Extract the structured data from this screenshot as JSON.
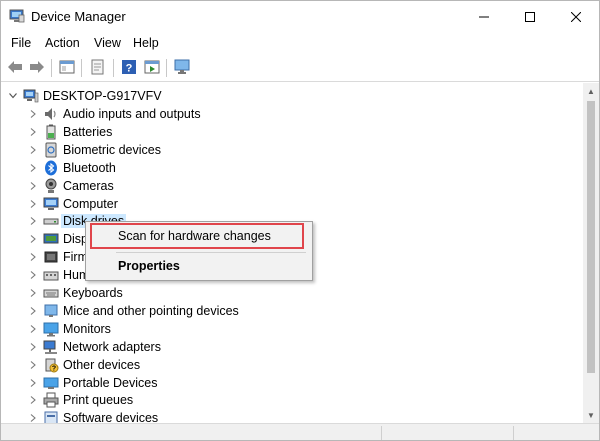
{
  "window": {
    "title": "Device Manager",
    "accent_highlight": "#e0454b",
    "selection_color": "#cce8ff"
  },
  "menu": {
    "items": [
      "File",
      "Action",
      "View",
      "Help"
    ]
  },
  "toolbar": {
    "buttons": [
      "back-arrow-icon",
      "forward-arrow-icon",
      "properties-pane-icon",
      "update-driver-icon",
      "help-icon",
      "action-pane-icon",
      "scan-monitor-icon"
    ]
  },
  "tree": {
    "root": "DESKTOP-G917VFV",
    "items": [
      {
        "label": "Audio inputs and outputs",
        "icon": "speaker-icon"
      },
      {
        "label": "Batteries",
        "icon": "battery-icon"
      },
      {
        "label": "Biometric devices",
        "icon": "biometric-icon"
      },
      {
        "label": "Bluetooth",
        "icon": "bluetooth-icon"
      },
      {
        "label": "Cameras",
        "icon": "camera-icon"
      },
      {
        "label": "Computer",
        "icon": "computer-icon"
      },
      {
        "label": "Disk drives",
        "icon": "disk-drive-icon"
      },
      {
        "label": "Disp",
        "icon": "display-adapter-icon"
      },
      {
        "label": "Firm",
        "icon": "firmware-icon"
      },
      {
        "label": "Hum",
        "icon": "hid-icon"
      },
      {
        "label": "Keyboards",
        "icon": "keyboard-icon"
      },
      {
        "label": "Mice and other pointing devices",
        "icon": "mouse-icon"
      },
      {
        "label": "Monitors",
        "icon": "monitor-icon"
      },
      {
        "label": "Network adapters",
        "icon": "network-icon"
      },
      {
        "label": "Other devices",
        "icon": "other-devices-icon"
      },
      {
        "label": "Portable Devices",
        "icon": "portable-device-icon"
      },
      {
        "label": "Print queues",
        "icon": "printer-icon"
      },
      {
        "label": "Software devices",
        "icon": "software-device-icon"
      }
    ]
  },
  "context_menu": {
    "scan": "Scan for hardware changes",
    "properties": "Properties"
  }
}
